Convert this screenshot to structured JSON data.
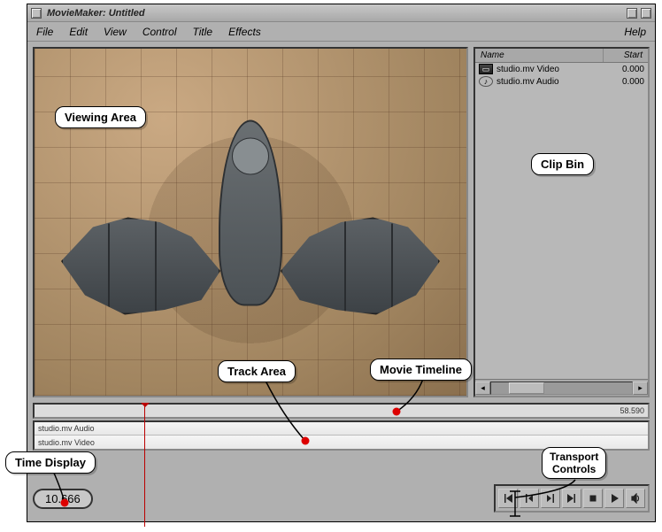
{
  "window": {
    "title": "MovieMaker: Untitled"
  },
  "menu": {
    "file": "File",
    "edit": "Edit",
    "view": "View",
    "control": "Control",
    "title": "Title",
    "effects": "Effects",
    "help": "Help"
  },
  "clipbin": {
    "header_name": "Name",
    "header_start": "Start",
    "rows": [
      {
        "icon": "video",
        "name": "studio.mv Video",
        "start": "0.000"
      },
      {
        "icon": "audio",
        "name": "studio.mv Audio",
        "start": "0.000"
      }
    ]
  },
  "timeline": {
    "end_time": "58.590"
  },
  "tracks": [
    {
      "label": "studio.mv Audio"
    },
    {
      "label": "studio.mv Video"
    }
  ],
  "time_display": "10.666",
  "callouts": {
    "viewing": "Viewing Area",
    "clipbin": "Clip Bin",
    "track": "Track Area",
    "timeline": "Movie Timeline",
    "timedisp": "Time Display",
    "transport": "Transport\nControls"
  }
}
